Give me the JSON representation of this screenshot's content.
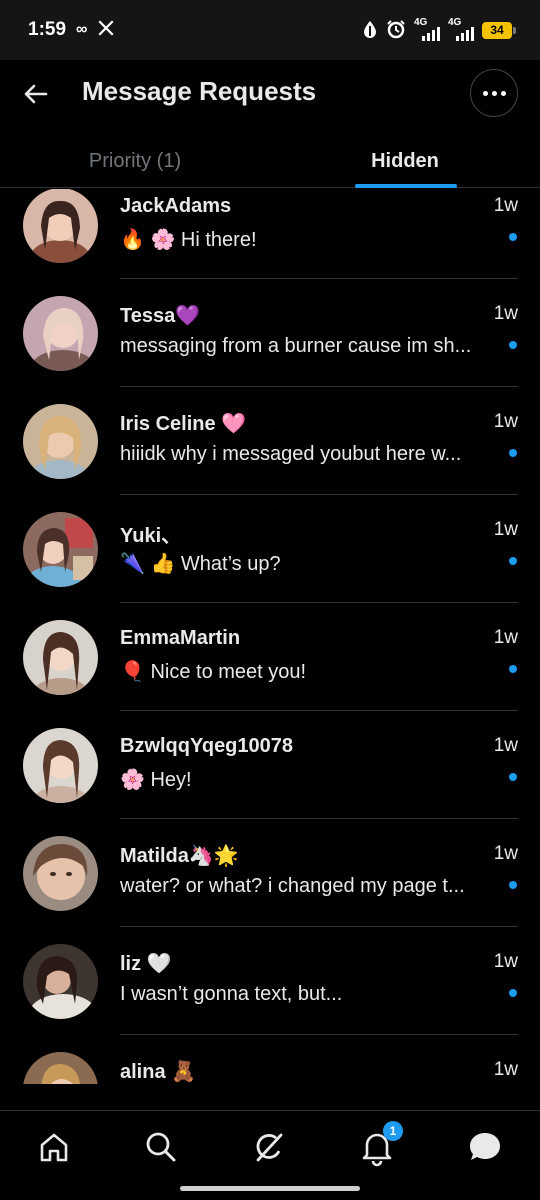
{
  "status_bar": {
    "time": "1:59",
    "network_1": "4G",
    "network_2": "4G",
    "battery": "34"
  },
  "header": {
    "title": "Message Requests"
  },
  "tabs": [
    {
      "label": "Priority (1)",
      "selected": false
    },
    {
      "label": "Hidden",
      "selected": true
    }
  ],
  "conversations": [
    {
      "name": "JackAdams",
      "time": "1w",
      "preview": "🔥 🌸 Hi there!",
      "unread": true
    },
    {
      "name": "Tessa💜",
      "time": "1w",
      "preview": "messaging from a burner cause im sh...",
      "unread": true
    },
    {
      "name": "Iris Celine 🩷",
      "time": "1w",
      "preview": "hiiidk why i messaged youbut here w...",
      "unread": true
    },
    {
      "name": "Yuki、",
      "time": "1w",
      "preview": "🌂 👍 What’s up?",
      "unread": true
    },
    {
      "name": "EmmaMartin",
      "time": "1w",
      "preview": "🎈 Nice to meet you!",
      "unread": true
    },
    {
      "name": "BzwlqqYqeg10078",
      "time": "1w",
      "preview": "🌸 Hey!",
      "unread": true
    },
    {
      "name": "Matilda🦄🌟",
      "time": "1w",
      "preview": "water? or what? i changed my page t...",
      "unread": true
    },
    {
      "name": "liz 🤍",
      "time": "1w",
      "preview": "I wasn’t gonna text, but...",
      "unread": true
    },
    {
      "name": "alina 🧸",
      "time": "1w",
      "preview": "",
      "unread": false
    }
  ],
  "bottom_nav": {
    "items": [
      "home-icon",
      "search-icon",
      "grok-icon",
      "notifications-icon",
      "messages-icon"
    ],
    "notifications_badge": "1"
  },
  "colors": {
    "accent": "#1d9bf0",
    "background": "#000000",
    "divider": "#2f3336",
    "muted_text": "#71767b"
  }
}
